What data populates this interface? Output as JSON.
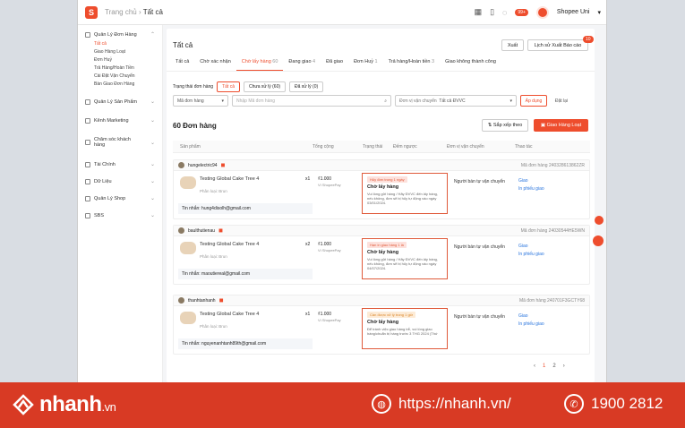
{
  "topbar": {
    "home": "Trang chủ",
    "current": "Tất cả",
    "notif": "99+",
    "shop_name": "Shopee Uni"
  },
  "sidebar": {
    "groups": [
      {
        "label": "Quản Lý Đơn Hàng",
        "items": [
          "Tất cả",
          "Giao Hàng Loạt",
          "Đơn Huỷ",
          "Trả Hàng/Hoàn Tiền",
          "Cài Đặt Vận Chuyển",
          "Bàn Giao Đơn Hàng"
        ]
      },
      {
        "label": "Quản Lý Sản Phẩm"
      },
      {
        "label": "Kênh Marketing"
      },
      {
        "label": "Chăm sóc khách hàng"
      },
      {
        "label": "Tài Chính"
      },
      {
        "label": "Dữ Liệu"
      },
      {
        "label": "Quản Lý Shop"
      },
      {
        "label": "SBS"
      }
    ]
  },
  "main": {
    "title": "Tất cả",
    "export": "Xuất",
    "export_history": "Lịch sử Xuất Báo cáo",
    "export_badge": "10",
    "tabs": [
      {
        "label": "Tất cả",
        "count": ""
      },
      {
        "label": "Chờ xác nhận",
        "count": ""
      },
      {
        "label": "Chờ lấy hàng",
        "count": "60"
      },
      {
        "label": "Đang giao",
        "count": "4"
      },
      {
        "label": "Đã giao",
        "count": ""
      },
      {
        "label": "Đơn Huỷ",
        "count": "1"
      },
      {
        "label": "Trả hàng/Hoàn tiền",
        "count": "3"
      },
      {
        "label": "Giao không thành công",
        "count": ""
      }
    ],
    "status_filter_label": "Trạng thái đơn hàng",
    "chips": [
      "Tất cả",
      "Chưa xử lý (60)",
      "Đã xử lý (0)"
    ],
    "search_field": "Mã đơn hàng",
    "search_placeholder": "Nhập Mã đơn hàng",
    "carrier_label": "Đơn vị vận chuyển",
    "carrier_value": "Tất cả ĐVVC",
    "apply": "Áp dụng",
    "reset": "Đặt lại",
    "order_count": "60 Đơn hàng",
    "sort": "Sắp xếp theo",
    "bulk_ship": "Giao Hàng Loạt",
    "columns": [
      "Sản phẩm",
      "Tổng cộng",
      "Trạng thái",
      "Đếm ngược",
      "Đơn vị vận chuyển",
      "Thao tác"
    ]
  },
  "orders": [
    {
      "buyer": "hungelectric94",
      "order_id": "Mã đơn hàng 240328613862ZR",
      "product": "Testing Global Cake Tree 4",
      "variant": "Phân loại: Brun",
      "qty": "x1",
      "price": "₫1.000",
      "payment": "Ví ShopeePay",
      "note": "Tin nhắn: hung4disolh@gmail.com",
      "tag": "Hủy đơn trong 1 ngày",
      "tag_color": "red",
      "status": "Chờ lấy hàng",
      "desc": "Vui lòng gửi hàng / Hãy ĐVVC đến lấy hàng, nếu không, đơn sẽ bị hủy tự động vào ngày 03/01/2024.",
      "shipping": "Người bán tự vận chuyển",
      "action1": "Giao",
      "action2": "In phiếu giao"
    },
    {
      "buyer": "baulthutienau",
      "order_id": "Mã đơn hàng 24030544HE5WN",
      "product": "Testing Global Cake Tree 4",
      "variant": "Phân loại: Brun",
      "qty": "x2",
      "price": "₫1.000",
      "payment": "Ví ShopeePay",
      "note": "Tin nhắn: maoutiereal@gmail.com",
      "tag": "Hạn in giao hàng 1 lá",
      "tag_color": "red",
      "status": "Chờ lấy hàng",
      "desc": "Vui lòng gửi hàng / Hãy ĐVVC đến lấy hàng, nếu không, đơn sẽ bị hủy tự động vào ngày 04/07/2024.",
      "shipping": "Người bán tự vận chuyển",
      "action1": "Giao",
      "action2": "In phiếu giao"
    },
    {
      "buyer": "thanhtanhanh",
      "order_id": "Mã đơn hàng 240701F3GCTY68",
      "product": "Testing Global Cake Tree 4",
      "variant": "Phân loại: Brun",
      "qty": "x1",
      "price": "₫1.000",
      "payment": "Ví ShopeePay",
      "note": "Tin nhắn: nguyenanhtanh89th@gmail.com",
      "tag": "Cần được xử lý trong 1 giờ",
      "tag_color": "orange",
      "status": "Chờ lấy hàng",
      "desc": "Để tránh việc giao hàng trễ, vui lòng giao hàng/chuẩn bị hàng trước 3 THG 2024 (Thứ",
      "shipping": "Người bán tự vận chuyển",
      "action1": "Giao",
      "action2": "In phiếu giao"
    }
  ],
  "pager": {
    "prev": "‹",
    "p1": "1",
    "p2": "2",
    "next": "›"
  },
  "footer": {
    "brand": "nhanh",
    "tld": ".vn",
    "url": "https://nhanh.vn/",
    "phone": "1900 2812"
  }
}
